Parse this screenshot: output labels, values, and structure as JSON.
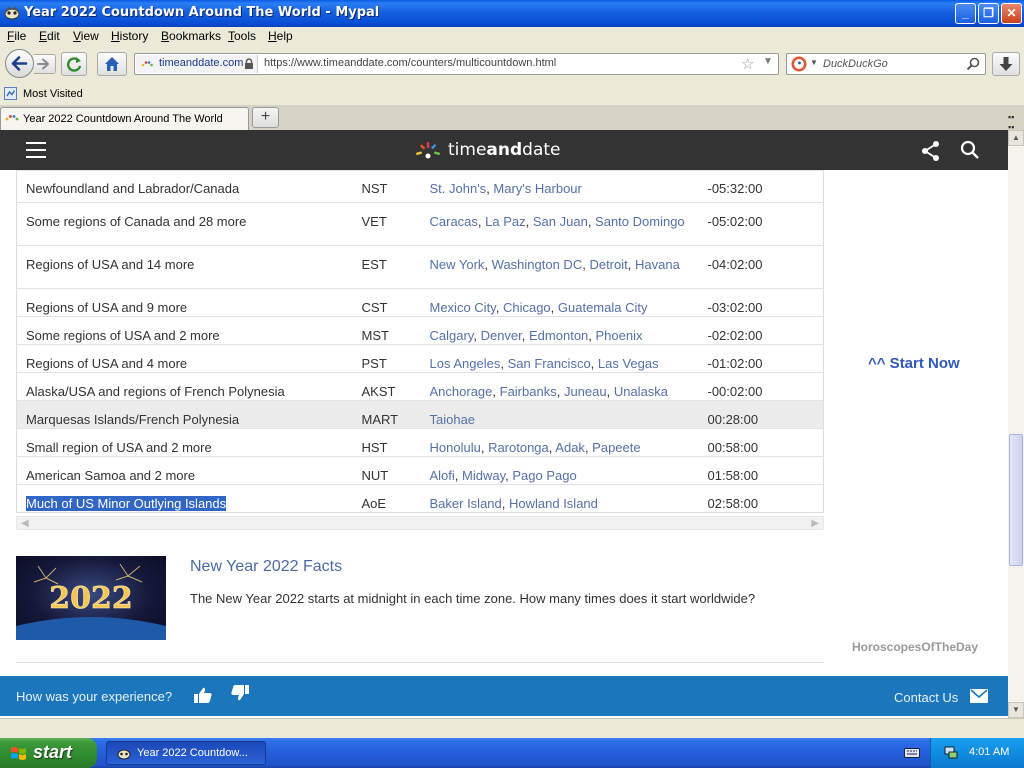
{
  "window": {
    "title": "Year 2022 Countdown Around The World - Mypal",
    "controls": {
      "minimize": "_",
      "maximize": "❐",
      "close": "✕"
    }
  },
  "menu": [
    "File",
    "Edit",
    "View",
    "History",
    "Bookmarks",
    "Tools",
    "Help"
  ],
  "nav": {
    "identity_domain": "timeanddate.com",
    "url": "https://www.timeanddate.com/counters/multicountdown.html",
    "search_placeholder": "DuckDuckGo"
  },
  "bookmarks": {
    "most_visited": "Most Visited"
  },
  "tabs": {
    "active": "Year 2022 Countdown Around The World",
    "new_tab": "+"
  },
  "site": {
    "logo_light": "time",
    "logo_bold": "and",
    "logo_end": "date"
  },
  "table": {
    "rows": [
      {
        "region": "Newfoundland and Labrador/Canada",
        "abbr": "NST",
        "cities": [
          "St. John's",
          "Mary's Harbour"
        ],
        "offset": "-05:32:00"
      },
      {
        "region": "Some regions of Canada and 28 more",
        "abbr": "VET",
        "cities": [
          "Caracas",
          "La Paz",
          "San Juan",
          "Santo Domingo"
        ],
        "offset": "-05:02:00"
      },
      {
        "region": "Regions of USA and 14 more",
        "abbr": "EST",
        "cities": [
          "New York",
          "Washington DC",
          "Detroit",
          "Havana"
        ],
        "offset": "-04:02:00"
      },
      {
        "region": "Regions of USA and 9 more",
        "abbr": "CST",
        "cities": [
          "Mexico City",
          "Chicago",
          "Guatemala City"
        ],
        "offset": "-03:02:00"
      },
      {
        "region": "Some regions of USA and 2 more",
        "abbr": "MST",
        "cities": [
          "Calgary",
          "Denver",
          "Edmonton",
          "Phoenix"
        ],
        "offset": "-02:02:00"
      },
      {
        "region": "Regions of USA and 4 more",
        "abbr": "PST",
        "cities": [
          "Los Angeles",
          "San Francisco",
          "Las Vegas"
        ],
        "offset": "-01:02:00"
      },
      {
        "region": "Alaska/USA and regions of French Polynesia",
        "abbr": "AKST",
        "cities": [
          "Anchorage",
          "Fairbanks",
          "Juneau",
          "Unalaska"
        ],
        "offset": "-00:02:00"
      },
      {
        "region": "Marquesas Islands/French Polynesia",
        "abbr": "MART",
        "cities": [
          "Taiohae"
        ],
        "offset": "00:28:00"
      },
      {
        "region": "Small region of USA and 2 more",
        "abbr": "HST",
        "cities": [
          "Honolulu",
          "Rarotonga",
          "Adak",
          "Papeete"
        ],
        "offset": "00:58:00"
      },
      {
        "region": "American Samoa and 2 more",
        "abbr": "NUT",
        "cities": [
          "Alofi",
          "Midway",
          "Pago Pago"
        ],
        "offset": "01:58:00"
      },
      {
        "region": "Much of US Minor Outlying Islands",
        "abbr": "AoE",
        "cities": [
          "Baker Island",
          "Howland Island"
        ],
        "offset": "02:58:00"
      }
    ]
  },
  "sidebar": {
    "start_now": "^^ Start Now",
    "horoscopes": "HoroscopesOfTheDay"
  },
  "facts": {
    "title": "New Year 2022 Facts",
    "text": "The New Year 2022 starts at midnight in each time zone. How many times does it start worldwide?",
    "image_text": "2022"
  },
  "feedback": {
    "question": "How was your experience?",
    "contact": "Contact Us"
  },
  "taskbar": {
    "start": "start",
    "task_label": "Year 2022 Countdow...",
    "clock": "4:01 AM"
  },
  "colors": {
    "site_header": "#333333",
    "link": "#5670a8",
    "feedback_bar": "#1b76bb",
    "selection": "#3166c5"
  }
}
